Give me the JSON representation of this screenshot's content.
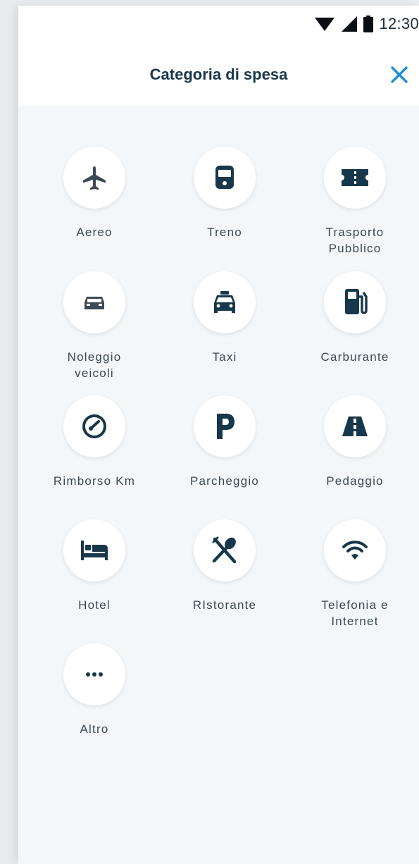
{
  "status_bar": {
    "time": "12:30"
  },
  "header": {
    "title": "Categoria di spesa"
  },
  "categories": [
    {
      "label": "Aereo",
      "icon": "airplane-icon"
    },
    {
      "label": "Treno",
      "icon": "train-icon"
    },
    {
      "label": "Trasporto\nPubblico",
      "icon": "ticket-icon"
    },
    {
      "label": "Noleggio\nveicoli",
      "icon": "car-icon"
    },
    {
      "label": "Taxi",
      "icon": "taxi-icon"
    },
    {
      "label": "Carburante",
      "icon": "fuel-pump-icon"
    },
    {
      "label": "Rimborso Km",
      "icon": "speedometer-icon"
    },
    {
      "label": "Parcheggio",
      "icon": "parking-icon"
    },
    {
      "label": "Pedaggio",
      "icon": "highway-icon"
    },
    {
      "label": "Hotel",
      "icon": "bed-icon"
    },
    {
      "label": "RIstorante",
      "icon": "fork-spoon-icon"
    },
    {
      "label": "Telefonia e\nInternet",
      "icon": "wifi-icon"
    },
    {
      "label": "Altro",
      "icon": "more-dots-icon"
    }
  ],
  "colors": {
    "icon_dark": "#17384a",
    "icon_grey": "#3d4a54",
    "close_accent": "#1a8fd0",
    "background": "#f4f7f9"
  }
}
